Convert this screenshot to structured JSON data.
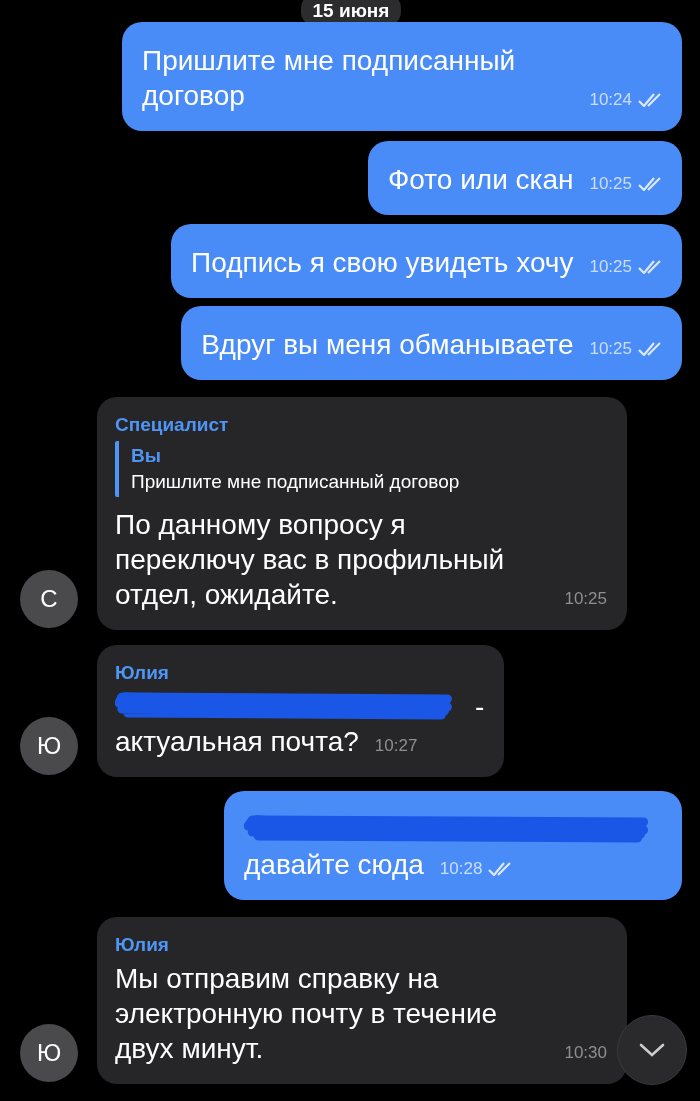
{
  "date_label": "15 июня",
  "messages": [
    {
      "kind": "outgoing",
      "text": "Пришлите мне подписанный договор",
      "time": "10:24",
      "read": true
    },
    {
      "kind": "outgoing",
      "text": "Фото или скан",
      "time": "10:25",
      "read": true
    },
    {
      "kind": "outgoing",
      "text": "Подпись я свою увидеть хочу",
      "time": "10:25",
      "read": true
    },
    {
      "kind": "outgoing",
      "text": "Вдруг вы меня обманываете",
      "time": "10:25",
      "read": true
    },
    {
      "kind": "incoming",
      "avatar": "С",
      "sender": "Специалист",
      "reply": {
        "sender": "Вы",
        "text": "Пришлите мне подписанный договор"
      },
      "text": "По данному вопросу я переключу вас в профильный отдел, ожидайте.",
      "time": "10:25"
    },
    {
      "kind": "incoming",
      "avatar": "Ю",
      "sender": "Юлия",
      "redacted": true,
      "after_redaction": "-",
      "text": "актуальная почта?",
      "time": "10:27"
    },
    {
      "kind": "outgoing",
      "redacted": true,
      "text": "давайте сюда",
      "time": "10:28",
      "read": true
    },
    {
      "kind": "incoming",
      "avatar": "Ю",
      "sender": "Юлия",
      "text": "Мы отправим справку на электронную почту в течение двух минут.",
      "time": "10:30"
    }
  ],
  "scroll_down_button": {
    "shown": true
  }
}
